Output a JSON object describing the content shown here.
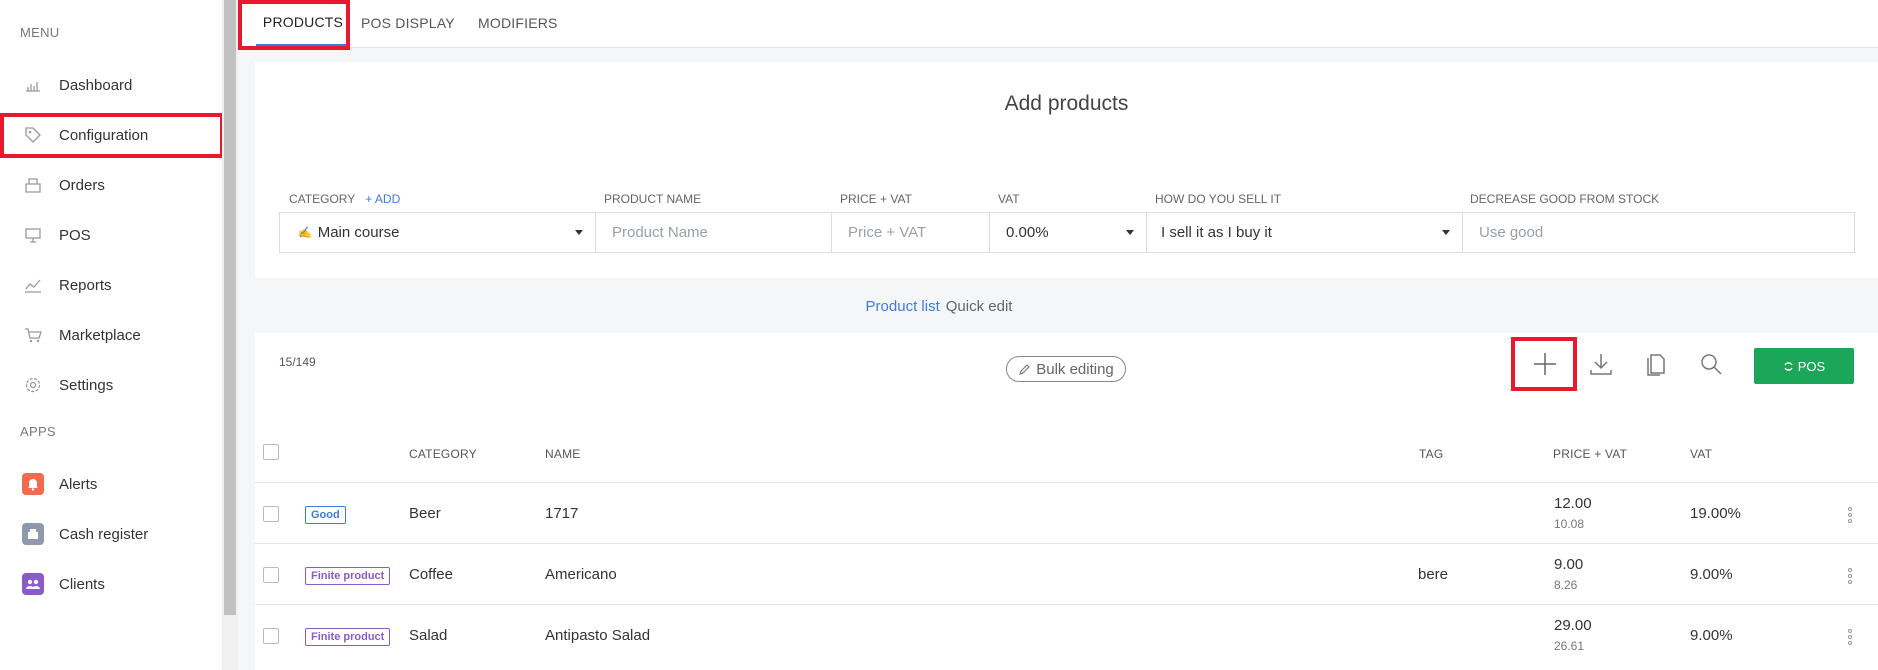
{
  "sidebar": {
    "menu_heading": "MENU",
    "apps_heading": "APPS",
    "items": [
      {
        "label": "Dashboard",
        "icon": "dashboard-icon"
      },
      {
        "label": "Configuration",
        "icon": "tag-icon"
      },
      {
        "label": "Orders",
        "icon": "orders-icon"
      },
      {
        "label": "POS",
        "icon": "pos-icon"
      },
      {
        "label": "Reports",
        "icon": "reports-icon"
      },
      {
        "label": "Marketplace",
        "icon": "cart-icon"
      },
      {
        "label": "Settings",
        "icon": "gear-icon"
      }
    ],
    "apps": [
      {
        "label": "Alerts",
        "icon": "bell-icon",
        "color": "#f26b4f"
      },
      {
        "label": "Cash register",
        "icon": "cash-register-icon",
        "color": "#8e9aab"
      },
      {
        "label": "Clients",
        "icon": "users-icon",
        "color": "#8a5cc9"
      }
    ]
  },
  "tabs": [
    "PRODUCTS",
    "POS DISPLAY",
    "MODIFIERS"
  ],
  "add_products": {
    "title": "Add products",
    "columns": {
      "category": "CATEGORY",
      "add": "+ ADD",
      "product_name": "PRODUCT NAME",
      "price_vat": "PRICE + VAT",
      "vat": "VAT",
      "how_sell": "HOW DO YOU SELL IT",
      "decrease_stock": "DECREASE GOOD FROM STOCK"
    },
    "fields": {
      "category_value": "Main course",
      "product_name_placeholder": "Product Name",
      "price_placeholder": "Price + VAT",
      "vat_value": "0.00%",
      "how_sell_value": "I sell it as I buy it",
      "stock_placeholder": "Use good"
    }
  },
  "views": {
    "product_list": "Product list",
    "quick_edit": "Quick edit"
  },
  "list": {
    "count": "15/149",
    "bulk_editing": "Bulk editing",
    "pos_button": "POS",
    "headers": {
      "category": "CATEGORY",
      "name": "NAME",
      "tag": "TAG",
      "price_vat": "PRICE + VAT",
      "vat": "VAT"
    },
    "rows": [
      {
        "type": "Good",
        "category": "Beer",
        "name": "1717",
        "tag": "",
        "price": "12.00",
        "price_net": "10.08",
        "vat": "19.00%"
      },
      {
        "type": "Finite product",
        "category": "Coffee",
        "name": "Americano",
        "tag": "bere",
        "price": "9.00",
        "price_net": "8.26",
        "vat": "9.00%"
      },
      {
        "type": "Finite product",
        "category": "Salad",
        "name": "Antipasto Salad",
        "tag": "",
        "price": "29.00",
        "price_net": "26.61",
        "vat": "9.00%"
      }
    ]
  },
  "colors": {
    "accent": "#3b7ddd",
    "highlight": "#e8192c",
    "pos_green": "#1aa75a",
    "finite_purple": "#8a5cc9"
  }
}
